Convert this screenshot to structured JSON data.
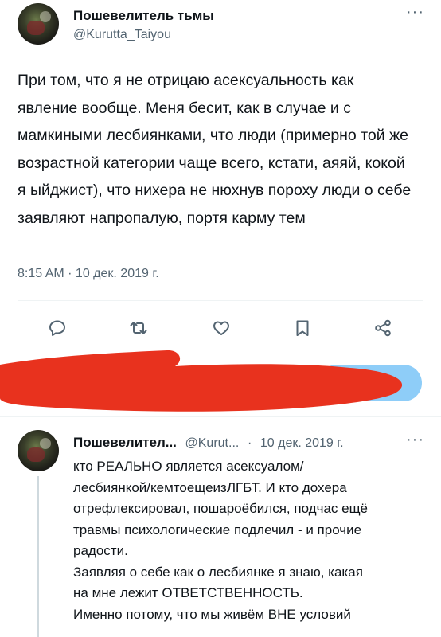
{
  "main_tweet": {
    "author_name": "Пошевелитель тьмы",
    "author_handle": "@Kurutta_Taiyou",
    "text": "При том, что я не отрицаю асексуальность как явление вообще. Меня бесит, как в случае и с мамкиными лесбиянками, что люди (примерно той же возрастной категории чаще всего, кстати, аяяй, кокой я ыйджист), что нихера не нюхнув пороху люди о себе заявляют напропалую, портя карму тем",
    "timestamp": "8:15 AM · 10 дек. 2019 г."
  },
  "actions": {
    "reply_icon": "reply-icon",
    "retweet_icon": "retweet-icon",
    "like_icon": "like-icon",
    "bookmark_icon": "bookmark-icon",
    "share_icon": "share-icon"
  },
  "reply_tweet": {
    "author_name": "Пошевелител...",
    "author_handle": "@Kurut...",
    "separator": "·",
    "date": "10 дек. 2019 г.",
    "lines": [
      "кто РЕАЛЬНО является асексуалом/",
      "лесбиянкой/кемтоещеизЛГБТ. И кто дохера",
      "отрефлексировал, пошароёбился, подчас ещё",
      "травмы психологические подлечил - и прочие",
      "радости.",
      "Заявляя о себе как о лесбиянке я знаю, какая",
      "на мне лежит ОТВЕТСТВЕННОСТЬ.",
      "Именно потому, что мы живём ВНЕ условий"
    ]
  },
  "colors": {
    "redaction": "#e8321e",
    "accent_blue": "#8ecdf8",
    "muted": "#536471"
  }
}
